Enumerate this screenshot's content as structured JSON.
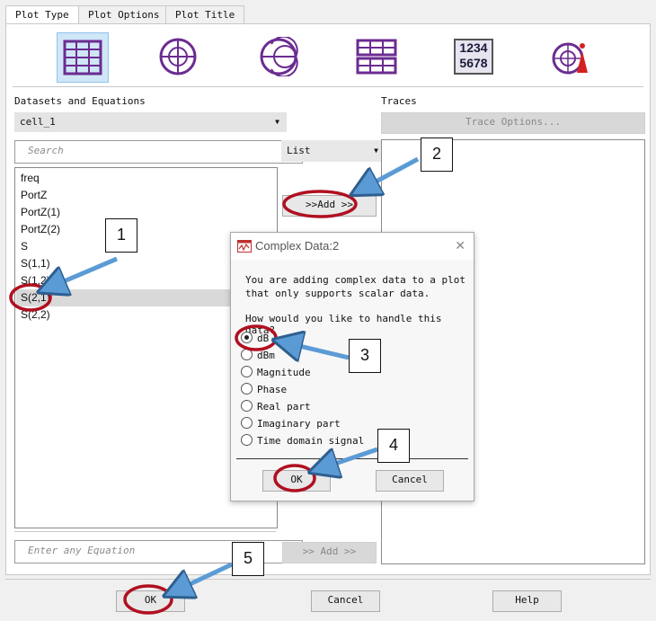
{
  "tabs": [
    {
      "label": "Plot Type",
      "active": true
    },
    {
      "label": "Plot Options",
      "active": false
    },
    {
      "label": "Plot Title",
      "active": false
    }
  ],
  "plot_types": [
    {
      "icon": "rectangular-plot-icon",
      "selected": true
    },
    {
      "icon": "polar-plot-icon",
      "selected": false
    },
    {
      "icon": "smith-chart-icon",
      "selected": false
    },
    {
      "icon": "stacked-rectangular-plot-icon",
      "selected": false
    },
    {
      "icon": "list-plot-icon",
      "selected": false,
      "text_top": "1234",
      "text_bottom": "5678"
    },
    {
      "icon": "antenna-plot-icon",
      "selected": false
    }
  ],
  "left": {
    "section_label": "Datasets and Equations",
    "dataset_combo": "cell_1",
    "search_placeholder": "Search",
    "view_mode": "List",
    "items": [
      "freq",
      "PortZ",
      "PortZ(1)",
      "PortZ(2)",
      "S",
      "S(1,1)",
      "S(1,2)",
      "S(2,1)",
      "S(2,2)"
    ],
    "selected_index": 7,
    "equation_placeholder": "Enter any Equation"
  },
  "middle": {
    "add_button": ">>Add >>",
    "add_equation_button": ">> Add >>"
  },
  "right": {
    "section_label": "Traces",
    "trace_options_button": "Trace Options..."
  },
  "dialog": {
    "title": "Complex Data:2",
    "message_line1": "You are adding complex data to a plot",
    "message_line2": "that only supports scalar data.",
    "question": "How would you like to handle this data?",
    "options": [
      "dB",
      "dBm",
      "Magnitude",
      "Phase",
      "Real part",
      "Imaginary part",
      "Time domain signal"
    ],
    "selected_option": 0,
    "ok": "OK",
    "cancel": "Cancel",
    "close_glyph": "✕"
  },
  "bottom": {
    "ok": "OK",
    "cancel": "Cancel",
    "help": "Help"
  },
  "callouts": [
    "1",
    "2",
    "3",
    "4",
    "5"
  ],
  "colors": {
    "highlight": "#b01020",
    "arrow": "#5b9bd5",
    "arrow_border": "#2e5f8f",
    "icon_purple": "#6b2c91"
  }
}
